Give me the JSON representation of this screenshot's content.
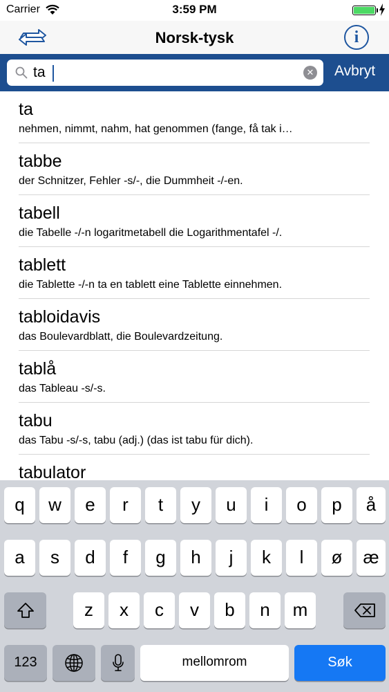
{
  "status_bar": {
    "carrier": "Carrier",
    "time": "3:59 PM",
    "battery_color": "#4cd964"
  },
  "nav": {
    "title": "Norsk-tysk",
    "swap_icon": "swap-arrows-icon",
    "info_icon": "info-icon",
    "info_glyph": "i",
    "accent": "#1e56a0"
  },
  "search": {
    "value": "ta",
    "placeholder": "",
    "cancel_label": "Avbryt",
    "clear_glyph": "✕",
    "bar_color": "#1d4e8f"
  },
  "results": [
    {
      "headword": "ta",
      "translation": "nehmen, nimmt, nahm, hat genommen (fange, få tak i…"
    },
    {
      "headword": "tabbe",
      "translation": "der Schnitzer, Fehler -s/-, die Dummheit -/-en."
    },
    {
      "headword": "tabell",
      "translation": "die Tabelle -/-n logaritmetabell die Logarithmentafel -/."
    },
    {
      "headword": "tablett",
      "translation": "die Tablette -/-n ta en tablett eine Tablette einnehmen."
    },
    {
      "headword": "tabloidavis",
      "translation": "das Boulevardblatt, die Boulevardzeitung."
    },
    {
      "headword": "tablå",
      "translation": "das Tableau -s/-s."
    },
    {
      "headword": "tabu",
      "translation": "das Tabu -s/-s, tabu (adj.) (das ist tabu für dich)."
    },
    {
      "headword": "tabulator",
      "translation": ""
    }
  ],
  "keyboard": {
    "row1": [
      "q",
      "w",
      "e",
      "r",
      "t",
      "y",
      "u",
      "i",
      "o",
      "p",
      "å"
    ],
    "row2": [
      "a",
      "s",
      "d",
      "f",
      "g",
      "h",
      "j",
      "k",
      "l",
      "ø",
      "æ"
    ],
    "row3": [
      "z",
      "x",
      "c",
      "v",
      "b",
      "n",
      "m"
    ],
    "numbers_label": "123",
    "space_label": "mellomrom",
    "return_label": "Søk",
    "return_color": "#1578f4"
  }
}
